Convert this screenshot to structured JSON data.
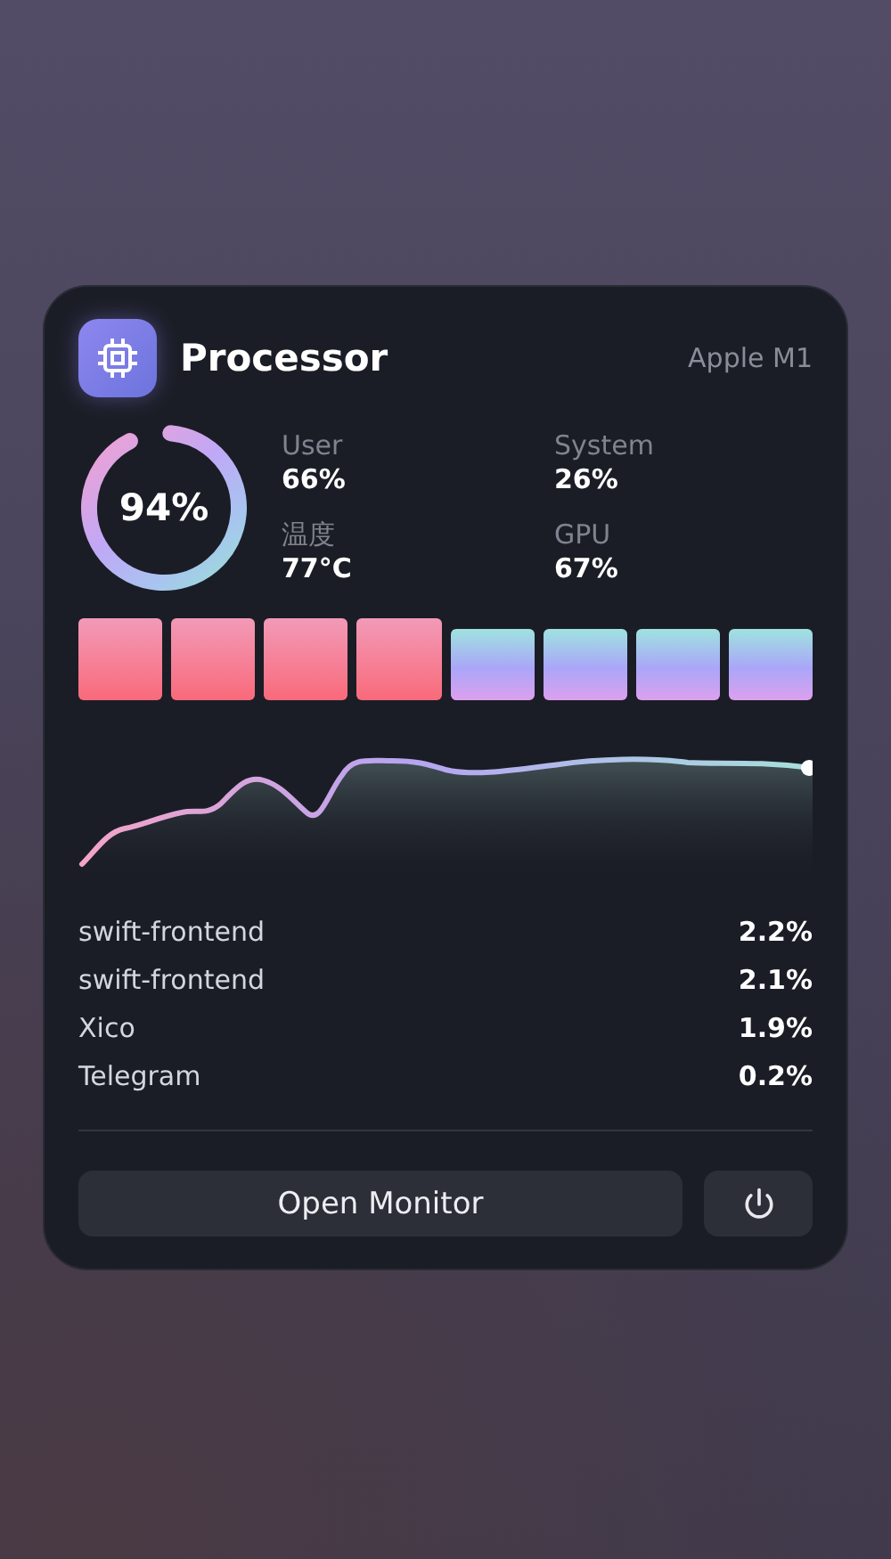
{
  "header": {
    "title": "Processor",
    "chip": "Apple M1"
  },
  "usage": {
    "level": 0.94,
    "reading": "94%"
  },
  "stats": [
    {
      "label": "User",
      "value": "66%"
    },
    {
      "label": "System",
      "value": "26%"
    },
    {
      "label": "温度",
      "value": "77°C"
    },
    {
      "label": "GPU",
      "value": "67%"
    }
  ],
  "cores": [
    {
      "kind": "performance"
    },
    {
      "kind": "performance"
    },
    {
      "kind": "performance"
    },
    {
      "kind": "performance"
    },
    {
      "kind": "efficiency"
    },
    {
      "kind": "efficiency"
    },
    {
      "kind": "efficiency"
    },
    {
      "kind": "efficiency"
    }
  ],
  "processes": [
    {
      "name": "swift-frontend",
      "value": "2.2%"
    },
    {
      "name": "swift-frontend",
      "value": "2.1%"
    },
    {
      "name": "Xico",
      "value": "1.9%"
    },
    {
      "name": "Telegram",
      "value": "0.2%"
    }
  ],
  "buttons": {
    "open": "Open Monitor"
  }
}
